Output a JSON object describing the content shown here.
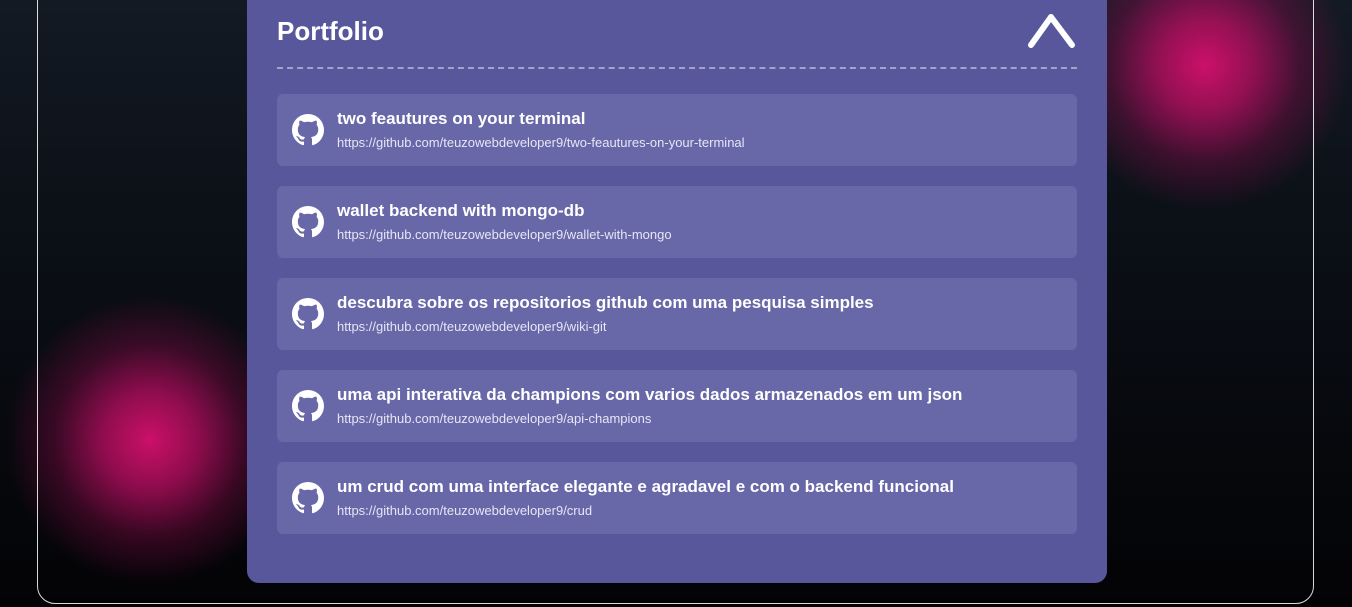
{
  "section": {
    "title": "Portfolio",
    "toggle_icon": "chevron-up-icon"
  },
  "repos": [
    {
      "name": "two feautures on your terminal",
      "url": "https://github.com/teuzowebdeveloper9/two-feautures-on-your-terminal",
      "icon": "github-icon"
    },
    {
      "name": "wallet backend with mongo-db",
      "url": "https://github.com/teuzowebdeveloper9/wallet-with-mongo",
      "icon": "github-icon"
    },
    {
      "name": "descubra sobre os repositorios github com uma pesquisa simples",
      "url": "https://github.com/teuzowebdeveloper9/wiki-git",
      "icon": "github-icon"
    },
    {
      "name": "uma api interativa da champions com varios dados armazenados em um json",
      "url": "https://github.com/teuzowebdeveloper9/api-champions",
      "icon": "github-icon"
    },
    {
      "name": "um crud com uma interface elegante e agradavel e com o backend funcional",
      "url": "https://github.com/teuzowebdeveloper9/crud",
      "icon": "github-icon"
    }
  ],
  "colors": {
    "panel": "#58579c",
    "item": "#6867a8",
    "glow": "#d6106e",
    "text": "#ffffff"
  }
}
